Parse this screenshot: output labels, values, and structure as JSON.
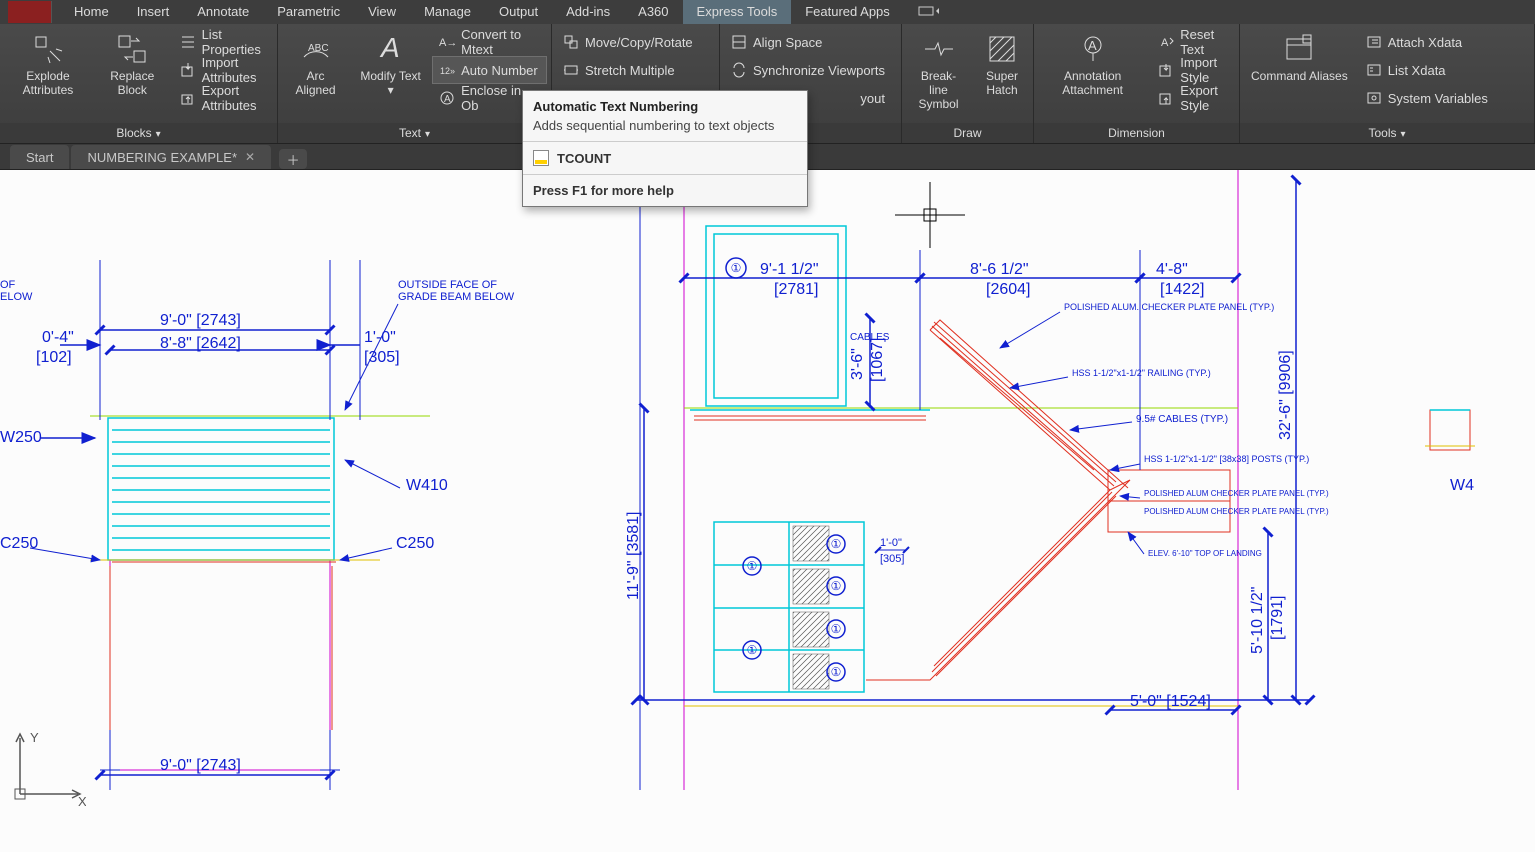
{
  "menus": [
    "Home",
    "Insert",
    "Annotate",
    "Parametric",
    "View",
    "Manage",
    "Output",
    "Add-ins",
    "A360",
    "Express Tools",
    "Featured Apps"
  ],
  "active_menu": "Express Tools",
  "ribbon": {
    "blocks": {
      "title": "Blocks",
      "explode": "Explode Attributes",
      "replace": "Replace Block",
      "list_props": "List Properties",
      "import_attr": "Import Attributes",
      "export_attr": "Export Attributes"
    },
    "text": {
      "title": "Text",
      "arc_aligned": "Arc Aligned",
      "modify_text": "Modify Text",
      "convert_mtext": "Convert to Mtext",
      "auto_number": "Auto Number",
      "enclose_obj": "Enclose in Ob"
    },
    "modify": {
      "move_copy": "Move/Copy/Rotate",
      "stretch": "Stretch Multiple"
    },
    "layout": {
      "align_space": "Align Space",
      "sync_vp": "Synchronize Viewports",
      "yout": "yout",
      "ut": "ut"
    },
    "draw": {
      "title": "Draw",
      "breakline": "Break-line Symbol",
      "superhatch": "Super Hatch"
    },
    "dimension": {
      "title": "Dimension",
      "annotation": "Annotation Attachment",
      "reset": "Reset Text",
      "import": "Import Style",
      "export": "Export Style"
    },
    "tools": {
      "title": "Tools",
      "command_aliases": "Command Aliases",
      "attach_x": "Attach Xdata",
      "list_x": "List Xdata",
      "sys_vars": "System Variables"
    }
  },
  "tabs": {
    "start": "Start",
    "file": "NUMBERING EXAMPLE*"
  },
  "tooltip": {
    "title": "Automatic Text Numbering",
    "desc": "Adds sequential numbering to text objects",
    "command": "TCOUNT",
    "help": "Press F1 for more help"
  },
  "drawing": {
    "left": {
      "dim_of_elow": [
        "OF",
        "ELOW"
      ],
      "outside_face": [
        "OUTSIDE FACE OF",
        "GRADE BEAM BELOW"
      ],
      "d1": "9'-0\" [2743]",
      "d2": "8'-8\" [2642]",
      "d3": "0'-4\"",
      "d3b": "[102]",
      "d4": "1'-0\"",
      "d4b": "[305]",
      "w250": "W250",
      "w410": "W410",
      "c250_l": "C250",
      "c250_r": "C250",
      "d_bottom": "9'-0\" [2743]"
    },
    "right": {
      "d_top1": "9'-1 1/2\"",
      "d_top1b": "[2781]",
      "d_top2": "8'-6 1/2\"",
      "d_top2b": "[2604]",
      "d_top3": "4'-8\"",
      "d_top3b": "[1422]",
      "d_right_big": "32'-6\" [9906]",
      "d_left_big": "11'-9\" [3581]",
      "d_v1": "3'-6\"",
      "d_v1b": "[1067]",
      "d_bot_r": "5'-10 1/2\"",
      "d_bot_rb": "[1791]",
      "d_bot_w": "5'-0\" [1524]",
      "d_small_1": "1'-0\"",
      "d_small_1b": "[305]",
      "ann_checker": "POLISHED ALUM. CHECKER PLATE PANEL (TYP.)",
      "ann_cables_tl": "CABLES",
      "ann_hss1": "HSS 1-1/2\"x1-1/2\" RAILING (TYP.)",
      "ann_cables": "9.5# CABLES (TYP.)",
      "ann_hss2": "HSS 1-1/2\"x1-1/2\" [38x38] POSTS (TYP.)",
      "ann_checker2": "POLISHED ALUM CHECKER PLATE PANEL (TYP.)",
      "ann_checker3": "POLISHED ALUM CHECKER PLATE PANEL (TYP.)",
      "ann_elev": "ELEV. 6'-10\" TOP OF LANDING",
      "circle_num": "①",
      "w4": "W4"
    }
  }
}
